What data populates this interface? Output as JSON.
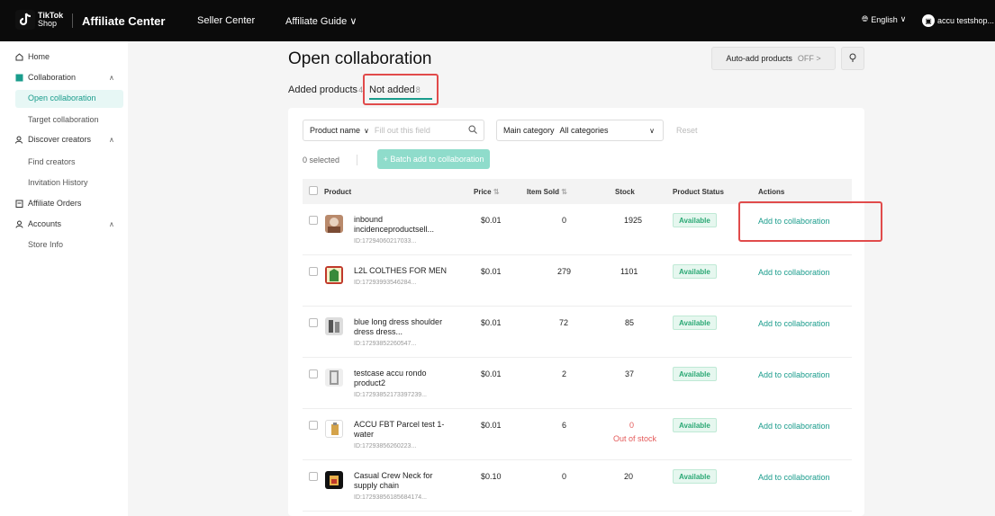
{
  "header": {
    "logo_line1": "TikTok",
    "logo_line2": "Shop",
    "brand": "Affiliate Center",
    "seller_center": "Seller Center",
    "affiliate_guide": "Affiliate Guide",
    "language": "English",
    "account": "accu testshop..."
  },
  "sidebar": {
    "home": "Home",
    "collaboration": "Collaboration",
    "open_collaboration": "Open collaboration",
    "target_collaboration": "Target collaboration",
    "discover_creators": "Discover creators",
    "find_creators": "Find creators",
    "invitation_history": "Invitation History",
    "affiliate_orders": "Affiliate Orders",
    "accounts": "Accounts",
    "store_info": "Store Info"
  },
  "main": {
    "title": "Open collaboration",
    "auto_add_label": "Auto-add products",
    "auto_add_state": "OFF >",
    "tabs": [
      {
        "label": "Added products",
        "count": "4"
      },
      {
        "label": "Not added",
        "count": "8"
      }
    ],
    "filter": {
      "field_label": "Product name",
      "placeholder": "Fill out this field",
      "category_label": "Main category",
      "category_value": "All categories",
      "reset": "Reset"
    },
    "selected_text": "0 selected",
    "batch_button": "+ Batch add to collaboration",
    "columns": [
      "Product",
      "Price",
      "Item Sold",
      "Stock",
      "Product Status",
      "Actions"
    ],
    "rows": [
      {
        "name": "inbound incidenceproductsell...",
        "id": "ID:17294060217033...",
        "price": "$0.01",
        "sold": "0",
        "stock": "1925",
        "stock_note": "",
        "status": "Available",
        "action": "Add to collaboration"
      },
      {
        "name": "L2L COLTHES FOR MEN",
        "id": "ID:17293993546284...",
        "price": "$0.01",
        "sold": "279",
        "stock": "1101",
        "stock_note": "",
        "status": "Available",
        "action": "Add to collaboration"
      },
      {
        "name": "blue long dress shoulder dress dress...",
        "id": "ID:17293852260547...",
        "price": "$0.01",
        "sold": "72",
        "stock": "85",
        "stock_note": "",
        "status": "Available",
        "action": "Add to collaboration"
      },
      {
        "name": "testcase accu rondo product2",
        "id": "ID:17293852173397239...",
        "price": "$0.01",
        "sold": "2",
        "stock": "37",
        "stock_note": "",
        "status": "Available",
        "action": "Add to collaboration"
      },
      {
        "name": "ACCU FBT Parcel test 1-water",
        "id": "ID:17293856260223...",
        "price": "$0.01",
        "sold": "6",
        "stock": "0",
        "stock_note": "Out of stock",
        "status": "Available",
        "action": "Add to collaboration"
      },
      {
        "name": "Casual Crew Neck for supply chain",
        "id": "ID:17293856185684174...",
        "price": "$0.10",
        "sold": "0",
        "stock": "20",
        "stock_note": "",
        "status": "Available",
        "action": "Add to collaboration"
      }
    ]
  },
  "colors": {
    "accent": "#1a9c8c",
    "highlight": "#e14b4b"
  }
}
